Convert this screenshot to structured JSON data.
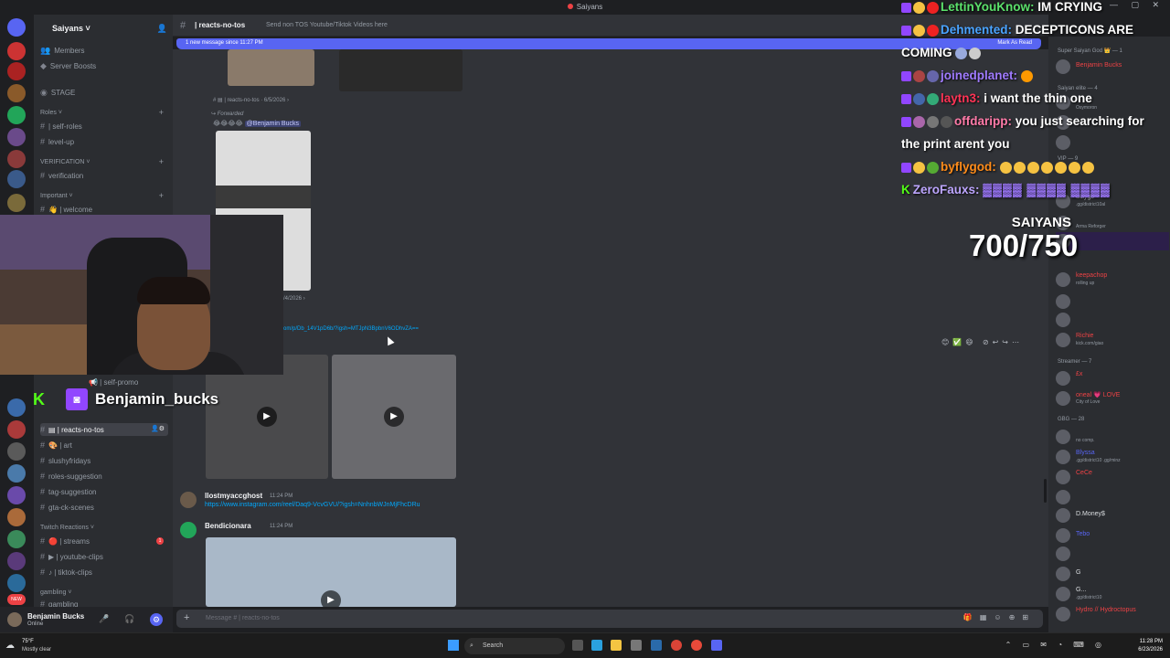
{
  "window": {
    "title": "Saiyans"
  },
  "server": {
    "name": "Saiyans ˅"
  },
  "channels": {
    "members": "Members",
    "boosts": "Server Boosts",
    "stage": "STAGE",
    "roles_cat": "Roles ˅",
    "self_roles": "self-roles",
    "level_up": "level-up",
    "verification_cat": "VERIFICATION ˅",
    "verification": "verification",
    "important_cat": "Important ˅",
    "welcome": "welcome",
    "self_promo": "self-promo",
    "reacts_no_tos": "reacts-no-tos",
    "art": "art",
    "slushyfridays": "slushyfridays",
    "roles_suggestion": "roles-suggestion",
    "tag_suggestion": "tag-suggestion",
    "gta_ck_scenes": "gta-ck-scenes",
    "twitch_cat": "Twitch Reactions ˅",
    "streams": "streams",
    "youtube_clips": "youtube-clips",
    "tiktok_clips": "tiktok-clips",
    "gambling_cat": "gambling ˅",
    "gambling": "gambling"
  },
  "user": {
    "name": "Benjamin Bucks",
    "status": "Online"
  },
  "header": {
    "channel": "reacts-no-tos",
    "topic": "Send non TOS Youtube/Tiktok Videos here"
  },
  "newbar": {
    "text": "1 new message since 11:27 PM",
    "mark": "Mark As Read"
  },
  "messages": {
    "reply_channel": "reacts-no-tos · 6/5/2026",
    "forwarded": "Forwarded",
    "mention": "@Benjamin Bucks",
    "date2": "/4/2026",
    "link1": "om/p/Db_14V1pD6b/?igsh=MTJpN3BpbnV6ODhvZA==",
    "user2": "llostmyaccghost",
    "time2": "11:24 PM",
    "link2": "https://www.instagram.com/reel/Daq9-VcvGVU/?igsh=NnhnbWJnMjFhcDRu",
    "user3": "Bendicionara",
    "time3": "11:24 PM"
  },
  "composer": {
    "placeholder": "Message # | reacts-no-tos"
  },
  "members_list": {
    "role1": "Super Saiyan God 👑 — 1",
    "m1": "Benjamin Bucks",
    "role2": "Saiyan elite — 4",
    "m2s": "Osymoron",
    "role3": "VIP — 9",
    "m3": "Daygo",
    "m3s": ".gg/district10al",
    "m4s": "Arma Reforger",
    "m5": "keepachop",
    "m5s": "rolling up",
    "m6": "Richie",
    "m6s": "kick.com/giao",
    "role4": "Streamer — 7",
    "m7": "£x",
    "m8": "oneal 💗 LOVE",
    "m8s": "City of Love",
    "role5": "GBG — 28",
    "m9s": "no comp.",
    "m10": "Blyssa",
    "m10s": ".gg/district10 .gg/minz",
    "m11": "CeCe",
    "m12": "D.Money$",
    "m13": "Tebo",
    "m14": "G",
    "m15": "G...",
    "m15s": ".gg/district10",
    "m16": "Hydro // Hydroctopus"
  },
  "overlay": {
    "c1_user": "LettinYouKnow:",
    "c1_msg": "IM CRYING",
    "c2_user": "Dehmented:",
    "c2_msg": "DECEPTICONS ARE",
    "c2_msg2": "COMING",
    "c3_user": "joinedplanet:",
    "c4_user": "laytn3:",
    "c4_msg": "i want the thin one",
    "c5_user": "offdaripp:",
    "c5_msg": "you just searching for",
    "c5_msg2": "the print arent you",
    "c6_user": "byflygod:",
    "c7_user": "ZeroFauxs:",
    "goal_label": "SAIYANS",
    "goal_value": "700/750",
    "streamer": "Benjamin_bucks"
  },
  "taskbar": {
    "temp": "75°F",
    "weather": "Mostly clear",
    "search": "Search",
    "time": "11:28 PM",
    "date": "6/23/2026"
  },
  "colors": {
    "blurple": "#5865f2",
    "twitch": "#9146ff",
    "kick": "#53fc18",
    "link": "#00a8fc"
  }
}
